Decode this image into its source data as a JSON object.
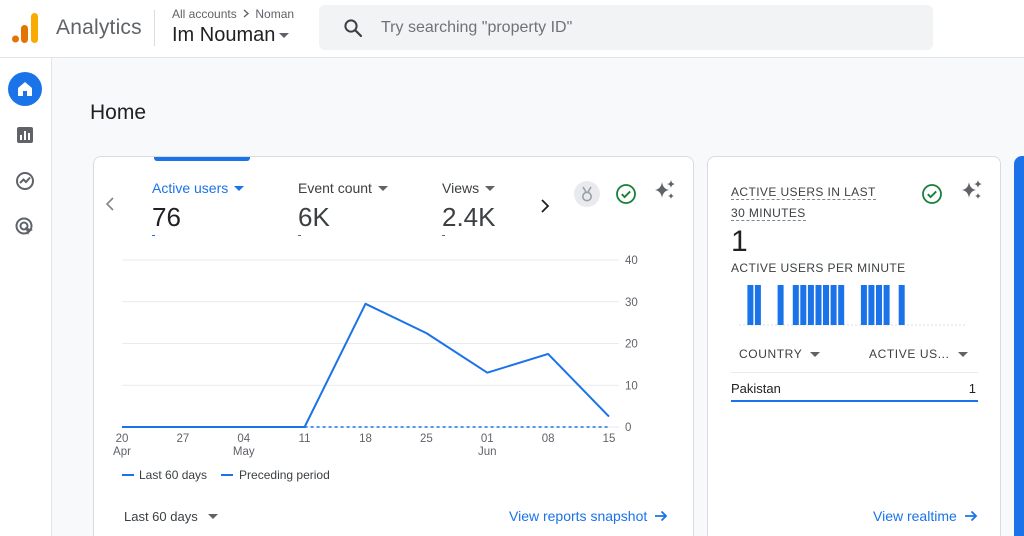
{
  "colors": {
    "accent": "#1a73e8",
    "logo_orange": "#f9ab00",
    "logo_dark": "#e37400",
    "success": "#188038"
  },
  "header": {
    "app_title": "Analytics",
    "breadcrumb_account": "All accounts",
    "breadcrumb_separator_icon": "chevron-right-icon",
    "breadcrumb_property": "Noman",
    "property_name": "Im Nouman",
    "search_placeholder": "Try searching \"property ID\""
  },
  "nav": {
    "items": [
      {
        "name": "home",
        "icon": "home-icon",
        "active": true
      },
      {
        "name": "reports",
        "icon": "bar-chart-icon",
        "active": false
      },
      {
        "name": "explore",
        "icon": "explore-icon",
        "active": false
      },
      {
        "name": "advertising",
        "icon": "advertising-icon",
        "active": false
      }
    ]
  },
  "page": {
    "title": "Home"
  },
  "overview": {
    "metrics": [
      {
        "label": "Active users",
        "value": "76",
        "active": true
      },
      {
        "label": "Event count",
        "value": "6K",
        "active": false
      },
      {
        "label": "Views",
        "value": "2.4K",
        "active": false
      }
    ],
    "legend": {
      "current": "Last 60 days",
      "previous": "Preceding period"
    },
    "range_label": "Last 60 days",
    "snapshot_link": "View reports snapshot"
  },
  "chart_data": {
    "type": "line",
    "x": [
      "20 Apr",
      "27 Apr",
      "04 May",
      "11 May",
      "18 May",
      "25 May",
      "01 Jun",
      "08 Jun",
      "15 Jun"
    ],
    "x_tick_labels": [
      "20",
      "27",
      "04",
      "11",
      "18",
      "25",
      "01",
      "08",
      "15"
    ],
    "x_month_labels": [
      {
        "at": 0,
        "label": "Apr"
      },
      {
        "at": 2,
        "label": "May"
      },
      {
        "at": 6,
        "label": "Jun"
      }
    ],
    "y_ticks": [
      "40",
      "30",
      "20",
      "10",
      "0"
    ],
    "ylim": [
      0,
      40
    ],
    "grid": true,
    "series": [
      {
        "name": "Last 60 days",
        "style": "solid",
        "values": [
          0,
          0,
          0,
          0,
          29.5,
          22.5,
          13,
          17.5,
          2.5
        ]
      },
      {
        "name": "Preceding period",
        "style": "dashed",
        "values": [
          null,
          null,
          null,
          0,
          0,
          0,
          0,
          0,
          0
        ]
      }
    ]
  },
  "realtime": {
    "title": "ACTIVE USERS IN LAST 30 MINUTES",
    "value": "1",
    "subtitle": "ACTIVE USERS PER MINUTE",
    "per_minute": [
      0,
      1,
      1,
      0,
      0,
      1,
      0,
      1,
      1,
      1,
      1,
      1,
      1,
      1,
      0,
      0,
      1,
      1,
      1,
      1,
      0,
      1,
      0,
      0,
      0,
      0,
      0,
      0,
      0,
      0
    ],
    "col_country": "COUNTRY",
    "col_users": "ACTIVE US...",
    "rows": [
      {
        "country": "Pakistan",
        "users": "1"
      }
    ],
    "link": "View realtime"
  }
}
